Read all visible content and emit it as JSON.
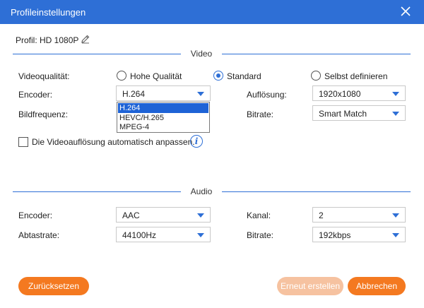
{
  "window": {
    "title": "Profileinstellungen",
    "close_icon": "close-icon"
  },
  "profile": {
    "label": "Profil: HD 1080P",
    "edit_icon": "pencil-icon"
  },
  "video": {
    "section_title": "Video",
    "quality_label": "Videoqualität:",
    "quality_options": [
      {
        "label": "Hohe Qualität",
        "selected": false
      },
      {
        "label": "Standard",
        "selected": true
      },
      {
        "label": "Selbst definieren",
        "selected": false
      }
    ],
    "encoder_label": "Encoder:",
    "encoder_value": "H.264",
    "encoder_options": [
      "H.264",
      "HEVC/H.265",
      "MPEG-4"
    ],
    "resolution_label": "Auflösung:",
    "resolution_value": "1920x1080",
    "framerate_label": "Bildfrequenz:",
    "bitrate_label": "Bitrate:",
    "bitrate_value": "Smart Match",
    "auto_resize_label": "Die Videoauflösung automatisch anpassen.",
    "auto_resize_checked": false
  },
  "audio": {
    "section_title": "Audio",
    "encoder_label": "Encoder:",
    "encoder_value": "AAC",
    "channel_label": "Kanal:",
    "channel_value": "2",
    "samplerate_label": "Abtastrate:",
    "samplerate_value": "44100Hz",
    "bitrate_label": "Bitrate:",
    "bitrate_value": "192kbps"
  },
  "buttons": {
    "reset": "Zurücksetzen",
    "create": "Erneut erstellen",
    "cancel": "Abbrechen"
  },
  "colors": {
    "accent": "#2e6fd6",
    "button": "#f47920",
    "button_disabled": "#f6c2a0"
  }
}
